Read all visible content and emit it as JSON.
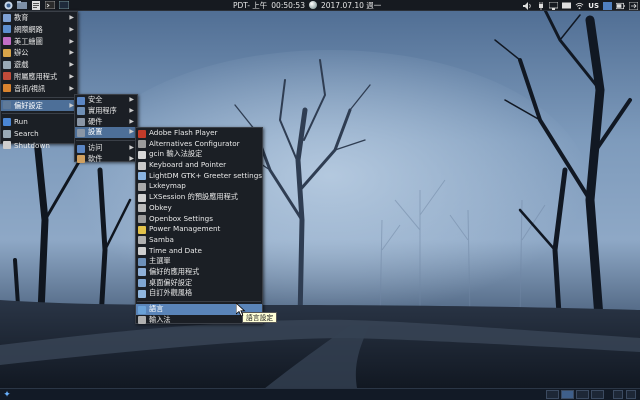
{
  "top_panel": {
    "clock_label": "PDT- 上午",
    "time": "00:50:53",
    "date": "2017.07.10 週一",
    "keyboard_layout": "US"
  },
  "main_menu": {
    "items": [
      {
        "label": "教育",
        "icon": "education-icon",
        "color": "#7fa2d6",
        "submenu": true
      },
      {
        "label": "網際網路",
        "icon": "internet-icon",
        "color": "#5d8fd0",
        "submenu": true
      },
      {
        "label": "美工繪圖",
        "icon": "graphics-icon",
        "color": "#c26ec7",
        "submenu": true
      },
      {
        "label": "辦公",
        "icon": "office-icon",
        "color": "#d9a54a",
        "submenu": true
      },
      {
        "label": "遊戲",
        "icon": "games-icon",
        "color": "#9aaab7",
        "submenu": true
      },
      {
        "label": "附屬應用程式",
        "icon": "accessories-icon",
        "color": "#c24c3a",
        "submenu": true
      },
      {
        "label": "音訊/視訊",
        "icon": "multimedia-icon",
        "color": "#d9832f",
        "submenu": true
      },
      {
        "label": "偏好設定",
        "icon": "preferences-icon",
        "color": "#5f7a99",
        "submenu": true,
        "selected": true
      },
      {
        "label": "Run",
        "icon": "run-icon",
        "color": "#4b87d6",
        "submenu": false
      },
      {
        "label": "Search",
        "icon": "search-icon",
        "color": "#9aaab7",
        "submenu": false
      },
      {
        "label": "Shutdown",
        "icon": "shutdown-icon",
        "color": "#cfcfcf",
        "submenu": false
      }
    ]
  },
  "prefs_menu": {
    "items": [
      {
        "label": "安全",
        "icon": "security-icon",
        "color": "#5b86c4",
        "submenu": true
      },
      {
        "label": "實用程序",
        "icon": "utilities-icon",
        "color": "#6f8fb5",
        "submenu": true
      },
      {
        "label": "硬件",
        "icon": "hardware-icon",
        "color": "#8a96a6",
        "submenu": true
      },
      {
        "label": "設置",
        "icon": "settings-icon",
        "color": "#8a96a6",
        "submenu": true,
        "selected": true
      },
      {
        "label": "访问",
        "icon": "access-icon",
        "color": "#5b86c4",
        "submenu": true
      },
      {
        "label": "軟件",
        "icon": "software-icon",
        "color": "#d0a060",
        "submenu": true
      }
    ]
  },
  "settings_menu": {
    "items": [
      {
        "label": "Adobe Flash Player",
        "icon": "flash-icon",
        "color": "#c23b2a"
      },
      {
        "label": "Alternatives Configurator",
        "icon": "alternatives-icon",
        "color": "#9b9b9b"
      },
      {
        "label": "gcin 輸入法設定",
        "icon": "gcin-icon",
        "color": "#d8d8d8"
      },
      {
        "label": "Keyboard and Pointer",
        "icon": "keyboard-icon",
        "color": "#c9c9c9"
      },
      {
        "label": "LightDM GTK+ Greeter settings",
        "icon": "lightdm-icon",
        "color": "#8ab3e0"
      },
      {
        "label": "Lxkeymap",
        "icon": "lxkeymap-icon",
        "color": "#aaaaaa"
      },
      {
        "label": "LXSession 的預設應用程式",
        "icon": "lxsession-icon",
        "color": "#d0d0d0"
      },
      {
        "label": "Obkey",
        "icon": "obkey-icon",
        "color": "#bbbbbb"
      },
      {
        "label": "Openbox Settings",
        "icon": "openbox-icon",
        "color": "#9c9c9c"
      },
      {
        "label": "Power Management",
        "icon": "power-icon",
        "color": "#e2c24a"
      },
      {
        "label": "Samba",
        "icon": "samba-icon",
        "color": "#b0b0b0"
      },
      {
        "label": "Time and Date",
        "icon": "clock-icon",
        "color": "#cfcfcf"
      },
      {
        "label": "主選單",
        "icon": "main-menu-icon",
        "color": "#6c8fb8"
      },
      {
        "label": "偏好的應用程式",
        "icon": "preferred-apps-icon",
        "color": "#8fb0d8"
      },
      {
        "label": "桌面偏好設定",
        "icon": "desktop-prefs-icon",
        "color": "#7fa6d2"
      },
      {
        "label": "自訂外觀風格",
        "icon": "appearance-icon",
        "color": "#8fb6df"
      },
      {
        "label": "語言",
        "icon": "language-icon",
        "color": "#6aa2d8",
        "selected": true
      },
      {
        "label": "輸入法",
        "icon": "input-method-icon",
        "color": "#b0b0b0"
      }
    ]
  },
  "tooltip": "語言設定",
  "colors": {
    "menu_bg": "#1b1f25",
    "highlight": "#4d6f98",
    "panel": "#161a20"
  }
}
